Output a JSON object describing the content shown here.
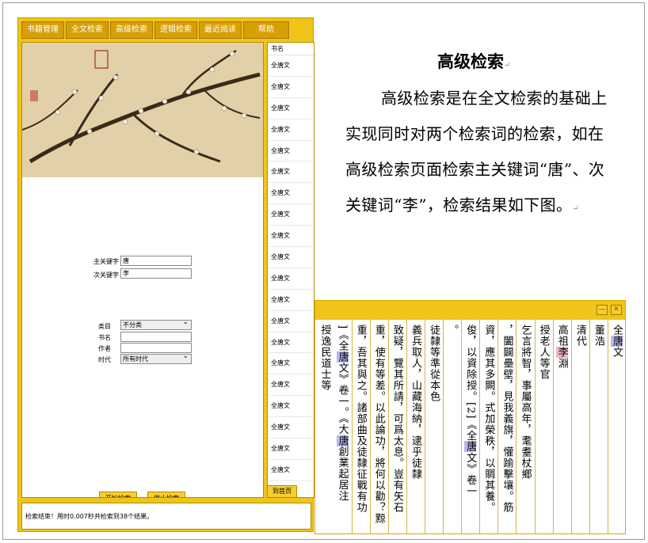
{
  "menu": [
    "书籍管理",
    "全文检索",
    "高级检索",
    "逻辑检索",
    "最近阅读",
    "帮助"
  ],
  "search": {
    "main_label": "主关键字",
    "main_value": "唐",
    "sub_label": "次关键字",
    "sub_value": "李",
    "category_label": "类目",
    "category_value": "不分类",
    "bookname_label": "书名",
    "author_label": "作者",
    "era_label": "时代",
    "era_value": "所有时代",
    "start_button": "开始检索",
    "stop_button": "停止检索"
  },
  "results": {
    "header": "书名",
    "rows": [
      "全唐文",
      "全唐文",
      "全唐文",
      "全唐文",
      "全唐文",
      "全唐文",
      "全唐文",
      "全唐文",
      "全唐文",
      "全唐文",
      "全唐文",
      "全唐文",
      "全唐文",
      "全唐文",
      "全唐文",
      "全唐文",
      "全唐文",
      "全唐文",
      "全唐文",
      "全唐文"
    ],
    "page_button": "到首页"
  },
  "status": "检索结束！用时0.007秒共检索到38个结果。",
  "doc": {
    "title": "高级检索",
    "para": "高级检索是在全文检索的基础上实现同时对两个检索词的检索，如在高级检索页面检索主关键词“唐”、次关键词“李”，检索结果如下图。"
  },
  "vertical_window": {
    "min_icon": "—",
    "close_icon": "✕",
    "columns": [
      [
        {
          "t": "全"
        },
        {
          "t": "唐",
          "h": "b"
        },
        {
          "t": "文"
        }
      ],
      [
        {
          "t": "董"
        },
        {
          "t": "浩"
        }
      ],
      [
        {
          "t": "清代"
        }
      ],
      [
        {
          "t": "高祖"
        },
        {
          "t": "李",
          "h": "p"
        },
        {
          "t": "淵"
        }
      ],
      [
        {
          "t": "授老人等官"
        }
      ],
      [
        {
          "t": "乞言將智，事屬高年，耄耋杖鄉"
        }
      ],
      [
        {
          "t": "，闔闢壘壁，見我義旗，懽踰擊壤。筋"
        }
      ],
      [
        {
          "t": "資，應其多闕。式加榮秩，以賙其養。"
        }
      ],
      [
        {
          "t": "俊，以資除授。[2]《全"
        },
        {
          "t": "唐",
          "h": "b"
        },
        {
          "t": "文》卷一"
        }
      ],
      [
        {
          "t": "。"
        }
      ],
      [
        {
          "t": "徒隸等準從本色"
        }
      ],
      [
        {
          "t": "義兵取人，山藏海納，逮乎徒隸"
        }
      ],
      [
        {
          "t": "致疑，覽其所請，可爲太息。豈有矢石"
        }
      ],
      [
        {
          "t": "重，使有等差。以此論功，將何以勸？黥"
        }
      ],
      [
        {
          "t": "重，吾其與之。諸部曲及徒隸征戰有功"
        }
      ],
      [
        {
          "t": "]《全"
        },
        {
          "t": "唐",
          "h": "b"
        },
        {
          "t": "文》卷一。《大"
        },
        {
          "t": "唐",
          "h": "b"
        },
        {
          "t": "創業起居注"
        }
      ],
      [
        {
          "t": "授逸民道士等"
        }
      ]
    ]
  }
}
